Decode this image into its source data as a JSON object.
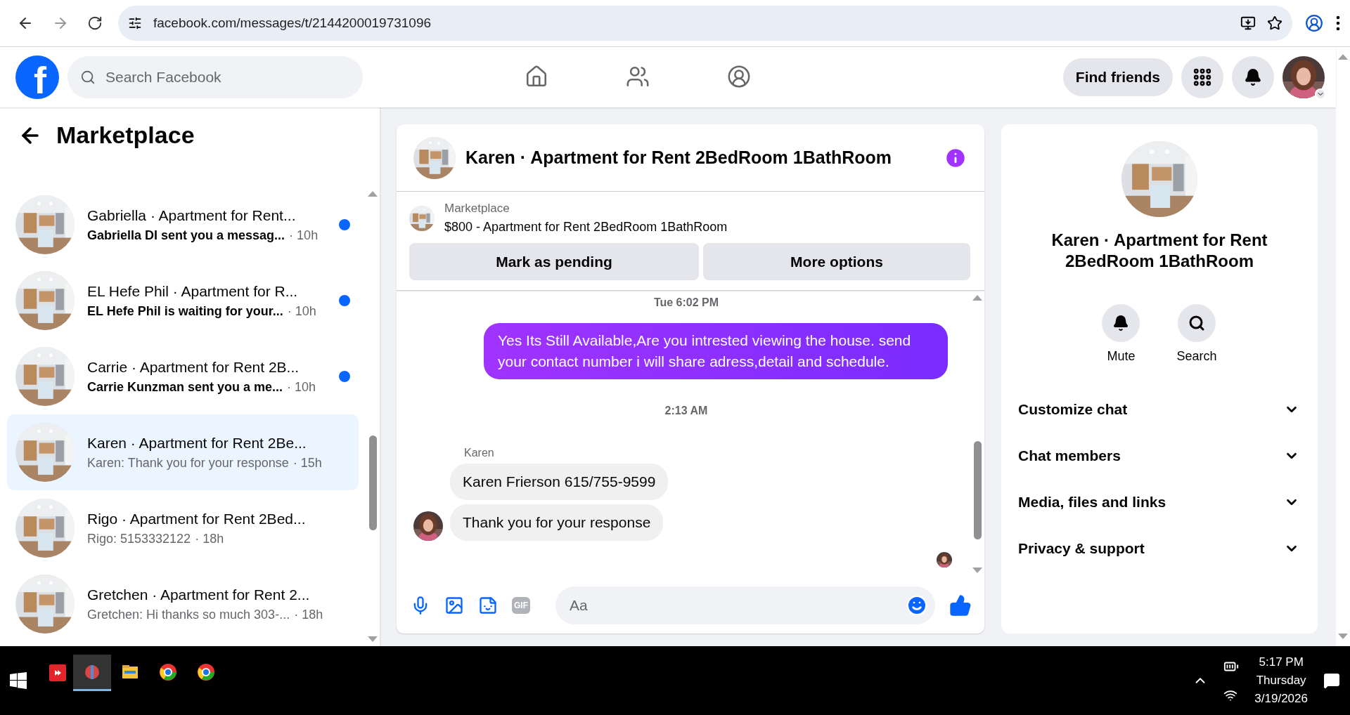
{
  "browser": {
    "url": "facebook.com/messages/t/2144200019731096"
  },
  "header": {
    "logo_text": "f",
    "search_placeholder": "Search Facebook",
    "nav": [
      {
        "kind": "home",
        "selected": false
      },
      {
        "kind": "friends",
        "selected": false
      },
      {
        "kind": "groups",
        "selected": false
      }
    ],
    "find_friends": "Find friends"
  },
  "sidebar": {
    "title": "Marketplace",
    "conversations": [
      {
        "title": "Gabriella · Apartment for Rent...",
        "preview": "Gabriella DI sent you a messag...",
        "time": "· 10h",
        "unread": true,
        "selected": false
      },
      {
        "title": "EL Hefe Phil · Apartment for R...",
        "preview": "EL Hefe Phil is waiting for your...",
        "time": "· 10h",
        "unread": true,
        "selected": false
      },
      {
        "title": "Carrie · Apartment for Rent 2B...",
        "preview": "Carrie Kunzman sent you a me...",
        "time": "· 10h",
        "unread": true,
        "selected": false
      },
      {
        "title": "Karen · Apartment for Rent 2Be...",
        "preview": "Karen: Thank you for your response",
        "time": "· 15h",
        "unread": false,
        "selected": true
      },
      {
        "title": "Rigo · Apartment for Rent 2Bed...",
        "preview": "Rigo: 5153332122",
        "time": "· 18h",
        "unread": false,
        "selected": false
      },
      {
        "title": "Gretchen · Apartment for Rent 2...",
        "preview": "Gretchen: Hi thanks so much 303-...",
        "time": "· 18h",
        "unread": false,
        "selected": false
      }
    ]
  },
  "chat": {
    "title": "Karen · Apartment for Rent 2BedRoom 1BathRoom",
    "listing": {
      "label": "Marketplace",
      "title": "$800 - Apartment for Rent 2BedRoom 1BathRoom"
    },
    "actions": [
      "Mark as pending",
      "More options"
    ],
    "messages": [
      {
        "kind": "time",
        "text": "Tue 6:02 PM"
      },
      {
        "kind": "outgoing",
        "text": "Yes Its Still Available,Are you intrested viewing the house. send your contact number i will share adress,detail and schedule."
      },
      {
        "kind": "time",
        "text": "2:13 AM"
      },
      {
        "kind": "sender",
        "text": "Karen"
      },
      {
        "kind": "incoming",
        "text": "Karen Frierson 615/755-9599"
      },
      {
        "kind": "incoming",
        "text": "Thank you for your response"
      }
    ],
    "gif_label": "GIF",
    "composer_placeholder": "Aa"
  },
  "details": {
    "name": "Karen · Apartment for Rent 2BedRoom 1BathRoom",
    "actions": [
      {
        "kind": "bell",
        "label": "Mute"
      },
      {
        "kind": "search",
        "label": "Search"
      }
    ],
    "sections": [
      {
        "label": "Customize chat",
        "expanded": false
      },
      {
        "label": "Chat members",
        "expanded": false
      },
      {
        "label": "Media, files and links",
        "expanded": false
      },
      {
        "label": "Privacy & support",
        "expanded": false
      }
    ]
  },
  "taskbar": {
    "time": "5:17 PM",
    "day": "Thursday",
    "date": "3/19/2026"
  }
}
